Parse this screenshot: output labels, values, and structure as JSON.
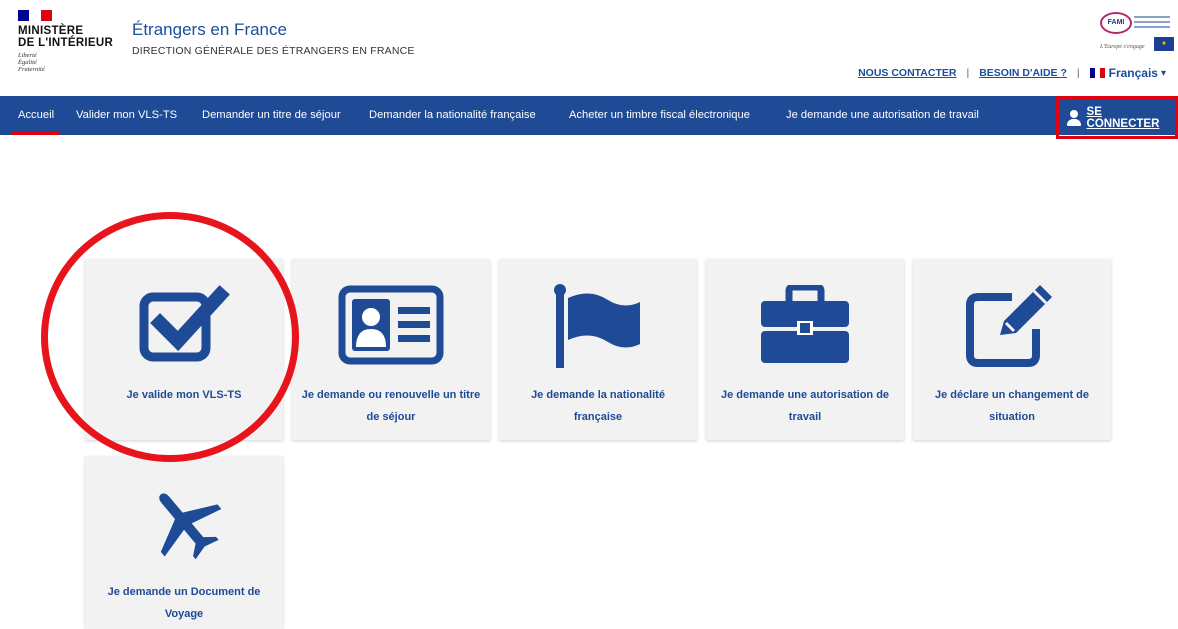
{
  "header": {
    "ministry_line1": "MINISTÈRE",
    "ministry_line2": "DE L'INTÉRIEUR",
    "devise": [
      "Liberté",
      "Égalité",
      "Fraternité"
    ],
    "site_title": "Étrangers en France",
    "site_subtitle": "DIRECTION GÉNÉRALE DES ÉTRANGERS EN FRANCE",
    "fami_logo": "FAMI",
    "fami_slogan": "L'Europe s'engage",
    "contact_link": "NOUS CONTACTER",
    "separator": "|",
    "help_link": "BESOIN D'AIDE ?",
    "language": "Français",
    "language_caret": "▾"
  },
  "nav": {
    "items": [
      {
        "label": "Accueil"
      },
      {
        "label": "Valider mon VLS-TS"
      },
      {
        "label": "Demander un titre de séjour"
      },
      {
        "label": "Demander la nationalité française"
      },
      {
        "label": "Acheter un timbre fiscal électronique"
      },
      {
        "label": "Je demande une autorisation de travail"
      }
    ],
    "connect_label": "SE CONNECTER"
  },
  "cards": [
    {
      "label_line1": "Je valide mon VLS-TS",
      "label_line2": "",
      "icon": "checkbox-icon"
    },
    {
      "label_line1": "Je demande ou renouvelle un titre",
      "label_line2": "de séjour",
      "icon": "id-card-icon"
    },
    {
      "label_line1": "Je demande la nationalité",
      "label_line2": "française",
      "icon": "flag-icon"
    },
    {
      "label_line1": "Je demande une autorisation de",
      "label_line2": "travail",
      "icon": "briefcase-icon"
    },
    {
      "label_line1": "Je déclare un changement de",
      "label_line2": "situation",
      "icon": "edit-icon"
    },
    {
      "label_line1": "Je demande un Document de",
      "label_line2": "Voyage",
      "icon": "airplane-icon"
    }
  ],
  "colors": {
    "brand_blue": "#1e4a96",
    "link_blue": "#1a4e9e",
    "highlight_red": "#e1000f",
    "card_bg": "#f2f2f2"
  }
}
